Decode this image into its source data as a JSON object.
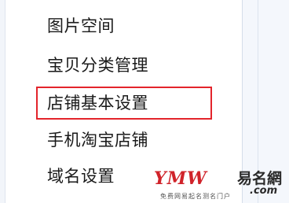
{
  "menu": {
    "items": [
      {
        "label": "图片空间"
      },
      {
        "label": "宝贝分类管理"
      },
      {
        "label": "店铺基本设置",
        "highlighted": true
      },
      {
        "label": "手机淘宝店铺"
      },
      {
        "label": "域名设置"
      }
    ]
  },
  "watermark": {
    "logo_text": "YMW",
    "cn_text": "易名網",
    "com_text": ".com",
    "sub_text": "免费网易起名测名门户"
  },
  "colors": {
    "highlight": "#e3242b",
    "text": "#1a1a1a",
    "watermark_red": "#d0232a"
  }
}
